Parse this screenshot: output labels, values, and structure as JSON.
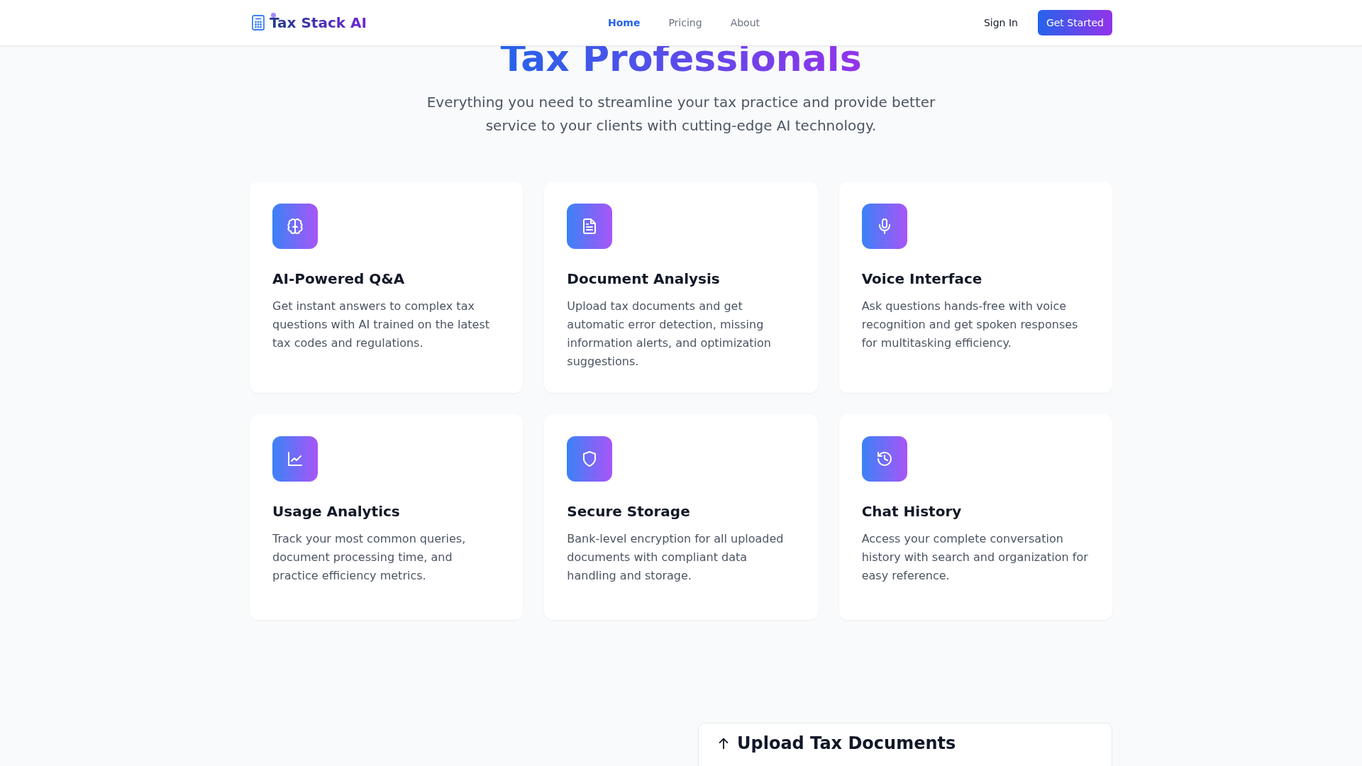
{
  "header": {
    "brand": "Tax Stack AI",
    "nav": [
      {
        "label": "Home",
        "selected": true
      },
      {
        "label": "Pricing",
        "selected": false
      },
      {
        "label": "About",
        "selected": false
      }
    ],
    "sign_in": "Sign In",
    "cta": "Get Started"
  },
  "hero": {
    "title": "Tax Professionals",
    "subtitle": "Everything you need to streamline your tax practice and provide better service to your clients with cutting-edge AI technology."
  },
  "features": [
    {
      "kind": "brain",
      "title": "AI-Powered Q&A",
      "description": "Get instant answers to complex tax questions with AI trained on the latest tax codes and regulations."
    },
    {
      "kind": "document",
      "title": "Document Analysis",
      "description": "Upload tax documents and get automatic error detection, missing information alerts, and optimization suggestions."
    },
    {
      "kind": "microphone",
      "title": "Voice Interface",
      "description": "Ask questions hands-free with voice recognition and get spoken responses for multitasking efficiency."
    },
    {
      "kind": "chart",
      "title": "Usage Analytics",
      "description": "Track your most common queries, document processing time, and practice efficiency metrics."
    },
    {
      "kind": "shield",
      "title": "Secure Storage",
      "description": "Bank-level encryption for all uploaded documents with compliant data handling and storage."
    },
    {
      "kind": "history",
      "title": "Chat History",
      "description": "Access your complete conversation history with search and organization for easy reference."
    }
  ],
  "upload": {
    "title": "Upload Tax Documents"
  }
}
